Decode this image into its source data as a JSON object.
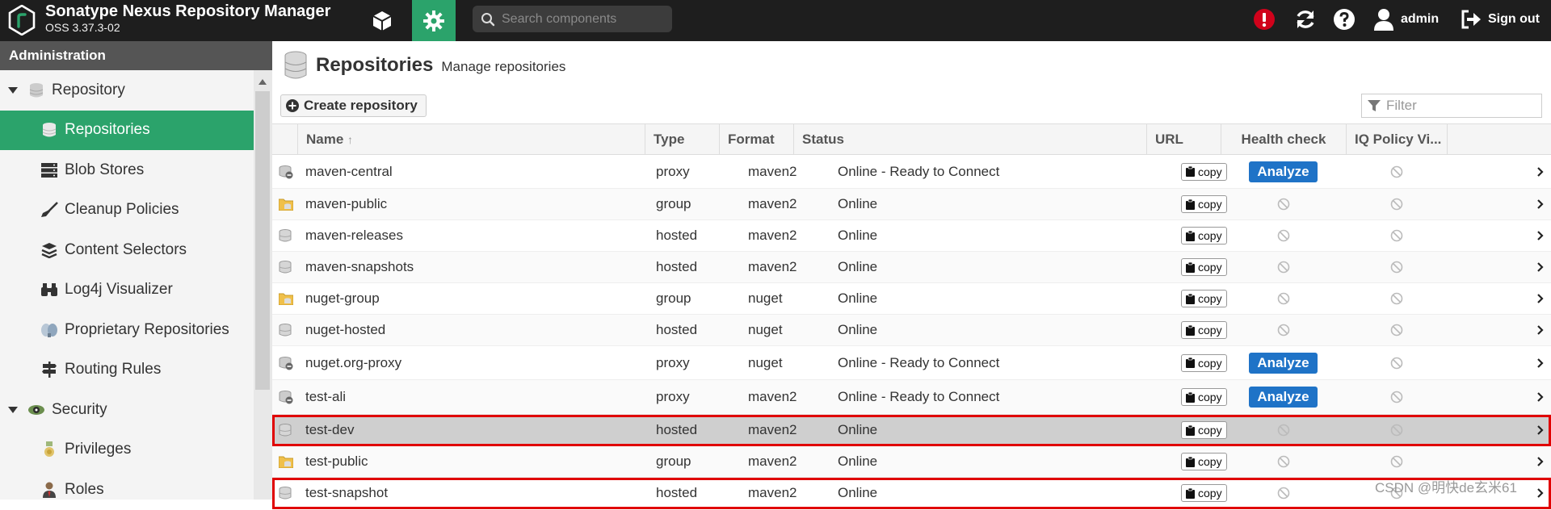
{
  "app": {
    "title": "Sonatype Nexus Repository Manager",
    "version": "OSS 3.37.3-02",
    "search_placeholder": "Search components",
    "user_name": "admin",
    "signout_label": "Sign out"
  },
  "sidebar": {
    "header": "Administration",
    "items": [
      {
        "label": "Repository",
        "kind": "category",
        "icon": "database-icon"
      },
      {
        "label": "Repositories",
        "kind": "sub",
        "icon": "database-icon",
        "active": true
      },
      {
        "label": "Blob Stores",
        "kind": "sub",
        "icon": "server-icon"
      },
      {
        "label": "Cleanup Policies",
        "kind": "sub",
        "icon": "broom-icon"
      },
      {
        "label": "Content Selectors",
        "kind": "sub",
        "icon": "layers-icon"
      },
      {
        "label": "Log4j Visualizer",
        "kind": "sub",
        "icon": "binoculars-icon"
      },
      {
        "label": "Proprietary Repositories",
        "kind": "sub",
        "icon": "proprietary-icon"
      },
      {
        "label": "Routing Rules",
        "kind": "sub",
        "icon": "signpost-icon"
      },
      {
        "label": "Security",
        "kind": "category",
        "icon": "eye-icon"
      },
      {
        "label": "Privileges",
        "kind": "sub",
        "icon": "medal-icon"
      },
      {
        "label": "Roles",
        "kind": "sub",
        "icon": "user-tie-icon"
      }
    ]
  },
  "page": {
    "title": "Repositories",
    "subtitle": "Manage repositories",
    "create_label": "Create repository",
    "filter_placeholder": "Filter"
  },
  "table": {
    "columns": [
      "Name",
      "Type",
      "Format",
      "Status",
      "URL",
      "Health check",
      "IQ Policy Vi..."
    ],
    "sort_indicator": "↑",
    "copy_label": "copy",
    "analyze_label": "Analyze",
    "rows": [
      {
        "name": "maven-central",
        "type": "proxy",
        "format": "maven2",
        "status": "Online - Ready to Connect",
        "health": "analyze"
      },
      {
        "name": "maven-public",
        "type": "group",
        "format": "maven2",
        "status": "Online",
        "health": "none"
      },
      {
        "name": "maven-releases",
        "type": "hosted",
        "format": "maven2",
        "status": "Online",
        "health": "none"
      },
      {
        "name": "maven-snapshots",
        "type": "hosted",
        "format": "maven2",
        "status": "Online",
        "health": "none"
      },
      {
        "name": "nuget-group",
        "type": "group",
        "format": "nuget",
        "status": "Online",
        "health": "none"
      },
      {
        "name": "nuget-hosted",
        "type": "hosted",
        "format": "nuget",
        "status": "Online",
        "health": "none"
      },
      {
        "name": "nuget.org-proxy",
        "type": "proxy",
        "format": "nuget",
        "status": "Online - Ready to Connect",
        "health": "analyze"
      },
      {
        "name": "test-ali",
        "type": "proxy",
        "format": "maven2",
        "status": "Online - Ready to Connect",
        "health": "analyze"
      },
      {
        "name": "test-dev",
        "type": "hosted",
        "format": "maven2",
        "status": "Online",
        "health": "none",
        "selected": true,
        "highlighted": true
      },
      {
        "name": "test-public",
        "type": "group",
        "format": "maven2",
        "status": "Online",
        "health": "none"
      },
      {
        "name": "test-snapshot",
        "type": "hosted",
        "format": "maven2",
        "status": "Online",
        "health": "none",
        "highlighted": true
      }
    ]
  },
  "watermark": "CSDN @明快de玄米61",
  "colors": {
    "topbar": "#1e1e1e",
    "accent_green": "#2ba36b",
    "analyze_blue": "#1f73c7",
    "highlight_red": "#e00000",
    "alert_red": "#d0021b"
  }
}
